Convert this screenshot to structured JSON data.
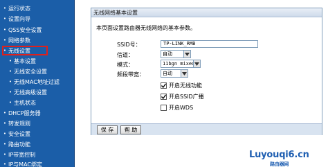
{
  "sidebar": {
    "items": [
      {
        "label": "运行状态"
      },
      {
        "label": "设置向导"
      },
      {
        "label": "QSS安全设置"
      },
      {
        "label": "网络参数"
      },
      {
        "label": "无线设置"
      },
      {
        "label": "基本设置"
      },
      {
        "label": "无线安全设置"
      },
      {
        "label": "无线MAC地址过滤"
      },
      {
        "label": "无线高级设置"
      },
      {
        "label": "主机状态"
      },
      {
        "label": "DHCP服务器"
      },
      {
        "label": "转发规则"
      },
      {
        "label": "安全设置"
      },
      {
        "label": "路由功能"
      },
      {
        "label": "IP带宽控制"
      },
      {
        "label": "IP与MAC绑定"
      }
    ],
    "selected": "无线设置"
  },
  "panel": {
    "title": "无线网络基本设置",
    "intro": "本页面设置路由器无线网络的基本参数。",
    "ssid_label": "SSID号：",
    "ssid_value": "TP-LINK_RMB",
    "channel_label": "信道：",
    "channel_value": "自动",
    "mode_label": "模式：",
    "mode_value": "11bgn mixed",
    "bandwidth_label": "频段带宽：",
    "bandwidth_value": "自动",
    "checks": [
      {
        "label": "开启无线功能",
        "checked": true
      },
      {
        "label": "开启SSID广播",
        "checked": true
      },
      {
        "label": "开启WDS",
        "checked": false
      }
    ]
  },
  "buttons": {
    "save": "保 存",
    "help": "帮 助"
  },
  "watermark": {
    "main": "Luyouqi6.cn",
    "sub": "路由器网"
  },
  "colors": {
    "sidebar_bg": "#1b5ea8",
    "highlight": "#e0201b",
    "panel_border": "#7f9db9"
  }
}
